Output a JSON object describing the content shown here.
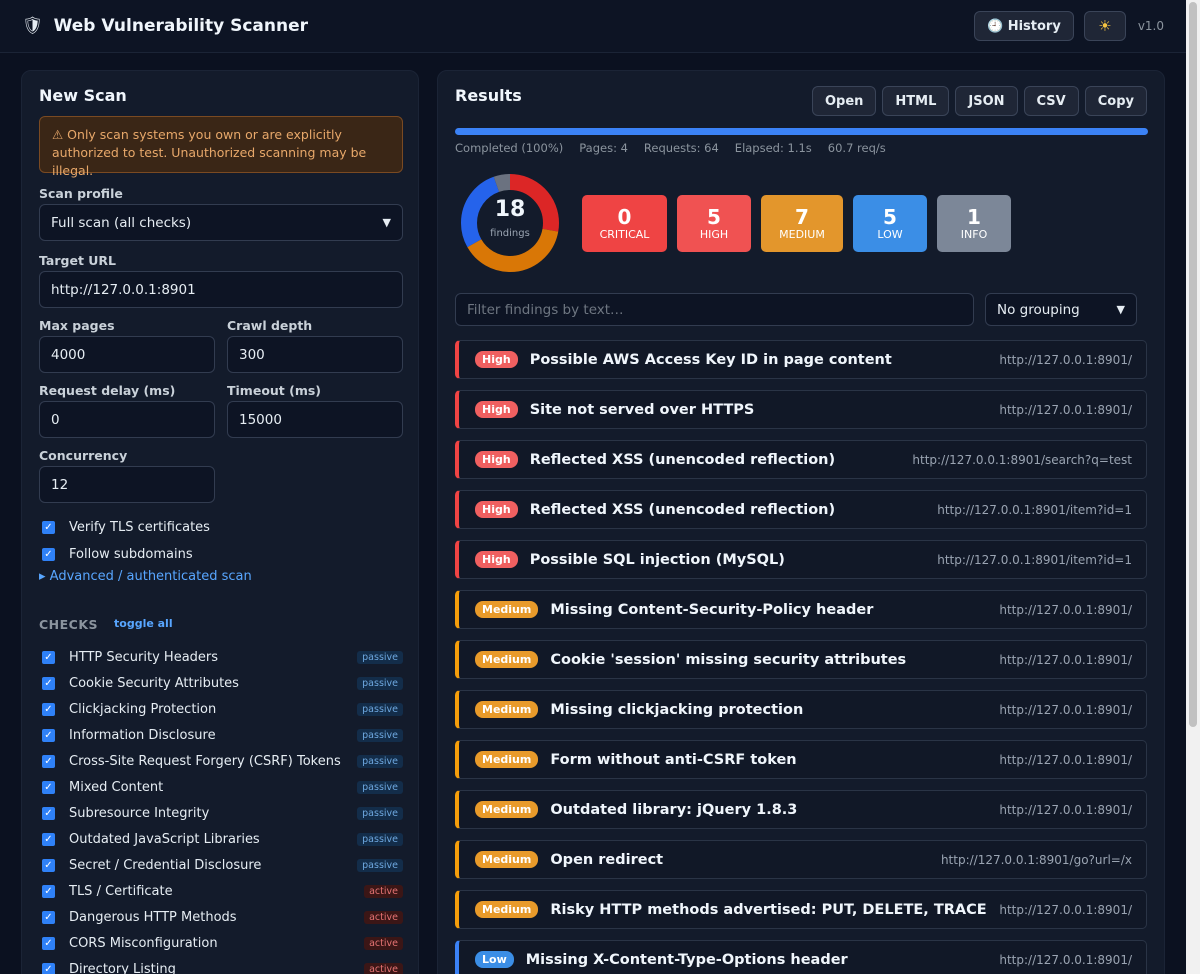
{
  "app": {
    "logo_icon": "shield-icon",
    "logo_glyph": "🛡",
    "title": "Web Vulnerability Scanner",
    "history_label": "🕘 History",
    "theme_glyph": "☀",
    "version": "v1.0"
  },
  "scan": {
    "heading": "New Scan",
    "warning": "⚠ Only scan systems you own or are explicitly authorized to test. Unauthorized scanning may be illegal.",
    "profile_label": "Scan profile",
    "profile_value": "Full scan (all checks)",
    "target_label": "Target URL",
    "target_value": "http://127.0.0.1:8901",
    "max_pages_label": "Max pages",
    "max_pages_value": "4000",
    "crawl_depth_label": "Crawl depth",
    "crawl_depth_value": "300",
    "delay_label": "Request delay (ms)",
    "delay_value": "0",
    "timeout_label": "Timeout (ms)",
    "timeout_value": "15000",
    "concurrency_label": "Concurrency",
    "concurrency_value": "12",
    "verify_tls_label": "Verify TLS certificates",
    "follow_subdomains_label": "Follow subdomains",
    "advanced_label": "▸ Advanced / authenticated scan",
    "checks_heading": "CHECKS",
    "toggle_all_label": "toggle all",
    "checks": [
      {
        "label": "HTTP Security Headers",
        "mode": "passive"
      },
      {
        "label": "Cookie Security Attributes",
        "mode": "passive"
      },
      {
        "label": "Clickjacking Protection",
        "mode": "passive"
      },
      {
        "label": "Information Disclosure",
        "mode": "passive"
      },
      {
        "label": "Cross-Site Request Forgery (CSRF) Tokens",
        "mode": "passive"
      },
      {
        "label": "Mixed Content",
        "mode": "passive"
      },
      {
        "label": "Subresource Integrity",
        "mode": "passive"
      },
      {
        "label": "Outdated JavaScript Libraries",
        "mode": "passive"
      },
      {
        "label": "Secret / Credential Disclosure",
        "mode": "passive"
      },
      {
        "label": "TLS / Certificate",
        "mode": "active"
      },
      {
        "label": "Dangerous HTTP Methods",
        "mode": "active"
      },
      {
        "label": "CORS Misconfiguration",
        "mode": "active"
      },
      {
        "label": "Directory Listing",
        "mode": "active"
      }
    ]
  },
  "results": {
    "heading": "Results",
    "export_buttons": [
      "Open",
      "HTML",
      "JSON",
      "CSV",
      "Copy"
    ],
    "progress_percent": 100,
    "status": "Completed (100%)",
    "pages": "Pages: 4",
    "requests": "Requests: 64",
    "elapsed": "Elapsed: 1.1s",
    "rate": "60.7 req/s",
    "total_findings": "18",
    "findings_label": "findings",
    "severity_counts": [
      {
        "key": "critical",
        "count": "0",
        "label": "CRITICAL",
        "color": "#ef4444"
      },
      {
        "key": "high",
        "count": "5",
        "label": "HIGH",
        "color": "#f05252"
      },
      {
        "key": "medium",
        "count": "7",
        "label": "MEDIUM",
        "color": "#e3962c"
      },
      {
        "key": "low",
        "count": "5",
        "label": "LOW",
        "color": "#3b8ee6"
      },
      {
        "key": "info",
        "count": "1",
        "label": "INFO",
        "color": "#7c8798"
      }
    ],
    "donut_colors": {
      "high": "#dc2626",
      "medium": "#d97706",
      "low": "#2563eb",
      "info": "#6b7280"
    },
    "filter_placeholder": "Filter findings by text…",
    "grouping_value": "No grouping",
    "findings": [
      {
        "severity": "high",
        "badge": "High",
        "title": "Possible AWS Access Key ID in page content",
        "url": "http://127.0.0.1:8901/"
      },
      {
        "severity": "high",
        "badge": "High",
        "title": "Site not served over HTTPS",
        "url": "http://127.0.0.1:8901/"
      },
      {
        "severity": "high",
        "badge": "High",
        "title": "Reflected XSS (unencoded reflection)",
        "url": "http://127.0.0.1:8901/search?q=test"
      },
      {
        "severity": "high",
        "badge": "High",
        "title": "Reflected XSS (unencoded reflection)",
        "url": "http://127.0.0.1:8901/item?id=1"
      },
      {
        "severity": "high",
        "badge": "High",
        "title": "Possible SQL injection (MySQL)",
        "url": "http://127.0.0.1:8901/item?id=1"
      },
      {
        "severity": "medium",
        "badge": "Medium",
        "title": "Missing Content-Security-Policy header",
        "url": "http://127.0.0.1:8901/"
      },
      {
        "severity": "medium",
        "badge": "Medium",
        "title": "Cookie 'session' missing security attributes",
        "url": "http://127.0.0.1:8901/"
      },
      {
        "severity": "medium",
        "badge": "Medium",
        "title": "Missing clickjacking protection",
        "url": "http://127.0.0.1:8901/"
      },
      {
        "severity": "medium",
        "badge": "Medium",
        "title": "Form without anti-CSRF token",
        "url": "http://127.0.0.1:8901/"
      },
      {
        "severity": "medium",
        "badge": "Medium",
        "title": "Outdated library: jQuery 1.8.3",
        "url": "http://127.0.0.1:8901/"
      },
      {
        "severity": "medium",
        "badge": "Medium",
        "title": "Open redirect",
        "url": "http://127.0.0.1:8901/go?url=/x"
      },
      {
        "severity": "medium",
        "badge": "Medium",
        "title": "Risky HTTP methods advertised: PUT, DELETE, TRACE",
        "url": "http://127.0.0.1:8901/"
      },
      {
        "severity": "low",
        "badge": "Low",
        "title": "Missing X-Content-Type-Options header",
        "url": "http://127.0.0.1:8901/"
      }
    ]
  }
}
